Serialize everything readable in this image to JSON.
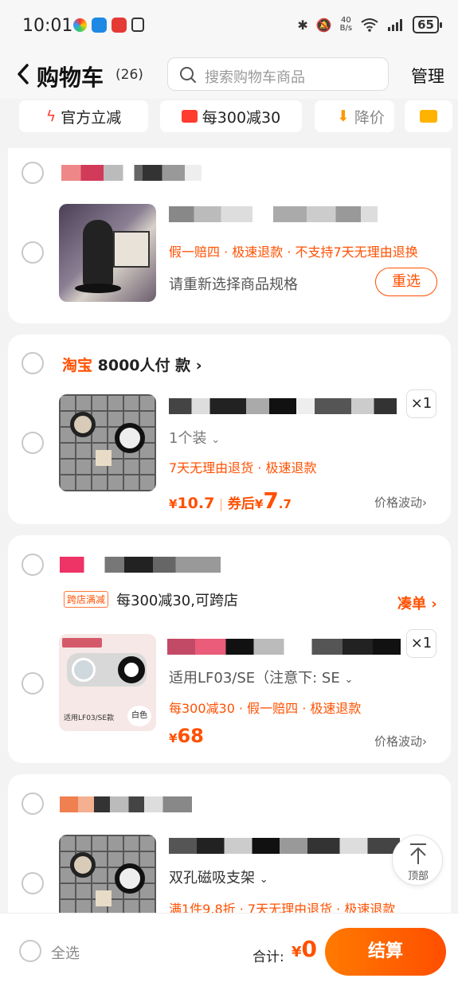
{
  "status_bar": {
    "time": "10:01",
    "net_speed_top": "40",
    "net_speed_bottom": "B/s",
    "battery": "65"
  },
  "header": {
    "title": "购物车",
    "count": "(26)",
    "search_placeholder": "搜索购物车商品",
    "manage_label": "管理"
  },
  "filters": [
    {
      "label": "官方立减",
      "icon": "lightning-icon"
    },
    {
      "label": "每300减30",
      "icon": "coupon-icon"
    },
    {
      "label": "降价",
      "icon": "arrow-down-icon"
    }
  ],
  "shops": [
    {
      "items": [
        {
          "services": "假一赔四 · 极速退款 · 不支持7天无理由退换",
          "note": "请重新选择商品规格",
          "action": "重选"
        }
      ]
    },
    {
      "shop_brand": "淘宝",
      "shop_name": "8000人付 款",
      "shop_arrow": "›",
      "items": [
        {
          "spec": "1个装",
          "services": "7天无理由退货 · 极速退款",
          "qty": "×1",
          "price_symbol": "¥",
          "price": "10.7",
          "coupon_label": "券后",
          "after_symbol": "¥",
          "after_int": "7",
          "after_dec": ".7",
          "trend": "价格波动"
        }
      ]
    },
    {
      "promo_tag": "跨店满减",
      "promo_text": "每300减30,可跨店",
      "promo_action": "凑单",
      "items": [
        {
          "spec": "适用LF03/SE（注意下:  SE",
          "services": "每300减30 · 假一赔四 · 极速退款",
          "qty": "×1",
          "price_symbol": "¥",
          "price": "68",
          "trend": "价格波动",
          "image_tag": "白色",
          "image_caption": "适用LF03/SE款"
        }
      ]
    },
    {
      "items": [
        {
          "spec": "双孔磁吸支架",
          "services": "满1件9.8折 · 7天无理由退货 · 极速退款"
        }
      ]
    }
  ],
  "float_top_label": "顶部",
  "bottom_bar": {
    "select_all": "全选",
    "total_label": "合计:",
    "total_symbol": "¥",
    "total": "0",
    "checkout": "结算"
  },
  "colors": {
    "accent": "#ff5000",
    "background": "#f3f3f3"
  }
}
